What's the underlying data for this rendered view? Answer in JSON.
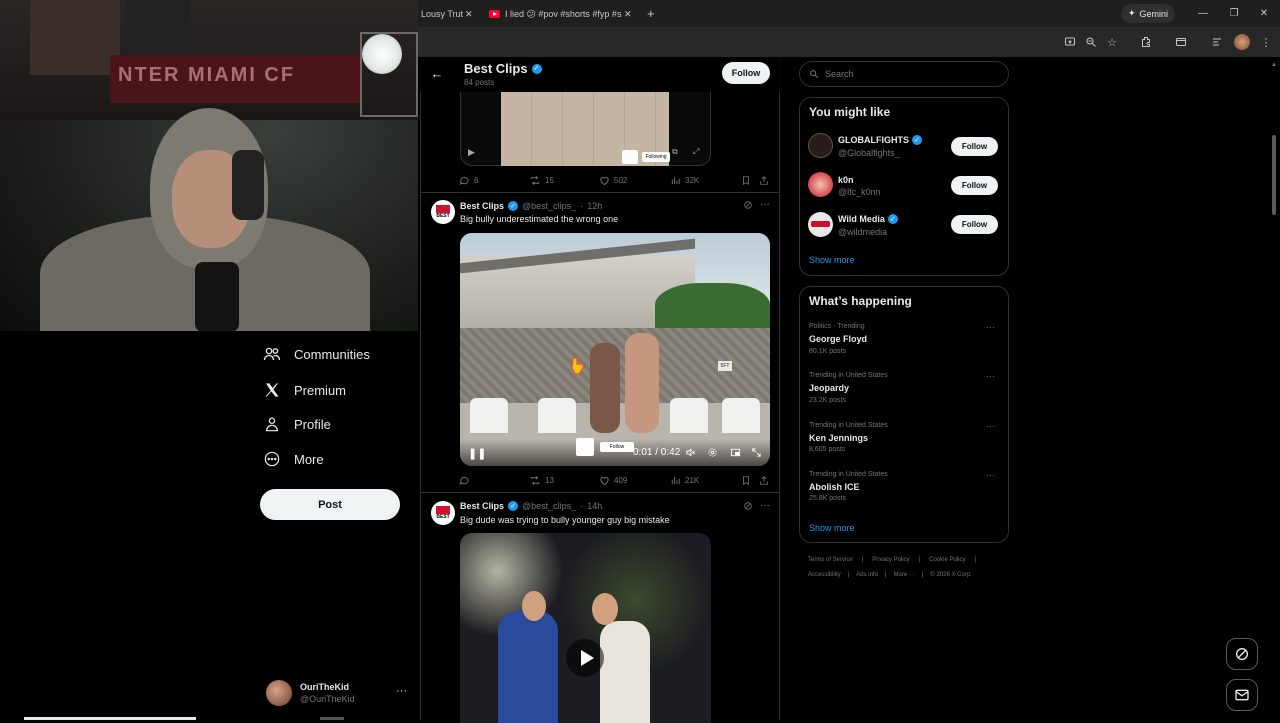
{
  "browser": {
    "tabs": [
      {
        "title": "Lousy Trut",
        "type": "plain"
      },
      {
        "title": "I lied 😕 #pov #shorts #fyp #s",
        "type": "youtube"
      }
    ],
    "new_tab": "+",
    "gemini_label": "Gemini",
    "window_controls": {
      "minimize": "—",
      "restore": "❐",
      "close": "✕"
    }
  },
  "x_nav": {
    "items": [
      {
        "label": "Communities",
        "icon": "communities-icon"
      },
      {
        "label": "Premium",
        "icon": "x-logo-icon"
      },
      {
        "label": "Profile",
        "icon": "profile-icon"
      },
      {
        "label": "More",
        "icon": "more-circle-icon"
      }
    ],
    "post_label": "Post",
    "account": {
      "name": "OuriTheKid",
      "handle": "@OuriTheKid",
      "more": "···"
    }
  },
  "timeline": {
    "header": {
      "title": "Best Clips",
      "posts_count": "84 posts",
      "follow_label": "Follow"
    },
    "prev_post": {
      "media_following": "Following",
      "stats": {
        "replies": "6",
        "reposts": "15",
        "likes": "502",
        "views": "32K"
      }
    },
    "posts": [
      {
        "name": "Best Clips",
        "handle": "@best_clips_",
        "time": "12h",
        "text": "Big bully underestimated the wrong one",
        "video": {
          "time": "0:01 / 0:42",
          "follow_overlay": "Follow",
          "sign": "5FT",
          "logo": "BEST"
        },
        "stats": {
          "replies": "",
          "reposts": "13",
          "likes": "409",
          "views": "21K"
        }
      },
      {
        "name": "Best Clips",
        "handle": "@best_clips_",
        "time": "14h",
        "text": "Big dude was trying to bully younger guy big mistake"
      }
    ],
    "avatar_label": "BEST"
  },
  "sidebar": {
    "search_placeholder": "Search",
    "you_might_like": {
      "title": "You might like",
      "accounts": [
        {
          "name": "GLOBALFIGHTS",
          "handle": "@Globalfights_",
          "verified": true,
          "follow": "Follow",
          "avatar_color": "#2a1a1a"
        },
        {
          "name": "k0n",
          "handle": "@lfc_k0nn",
          "verified": false,
          "follow": "Follow",
          "avatar_color": "#c8102e"
        },
        {
          "name": "Wild Media",
          "handle": "@wildmedia",
          "verified": true,
          "follow": "Follow",
          "avatar_color": "#e8e8e8"
        }
      ],
      "show_more": "Show more"
    },
    "whats_happening": {
      "title": "What’s happening",
      "trends": [
        {
          "context": "Politics · Trending",
          "name": "George Floyd",
          "count": "80.1K posts"
        },
        {
          "context": "Trending in United States",
          "name": "Jeopardy",
          "count": "23.2K posts"
        },
        {
          "context": "Trending in United States",
          "name": "Ken Jennings",
          "count": "8,605 posts"
        },
        {
          "context": "Trending in United States",
          "name": "Abolish ICE",
          "count": "25.8K posts"
        }
      ],
      "show_more": "Show more"
    },
    "footer": {
      "row1": [
        "Terms of Service",
        "Privacy Policy",
        "Cookie Policy"
      ],
      "row2": [
        "Accessibility",
        "Ads info",
        "More ···",
        "© 2026 X Corp."
      ]
    }
  },
  "colors": {
    "accent": "#1d9bf0",
    "background": "#000000",
    "border": "#2f3336",
    "muted": "#71767b"
  },
  "webcam": {
    "banner_text": "NTER MIAMI CF"
  }
}
